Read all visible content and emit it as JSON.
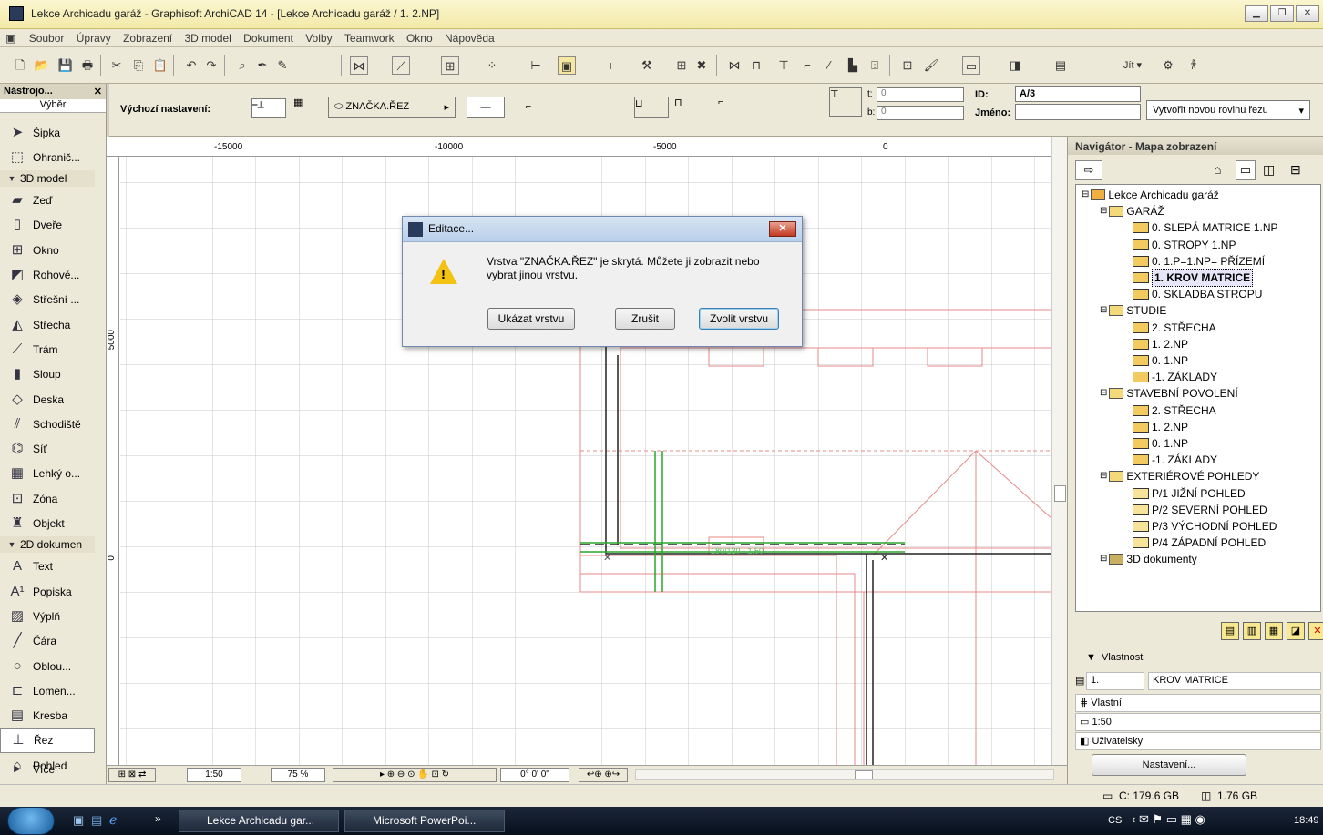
{
  "window": {
    "title": "Lekce Archicadu garáž - Graphisoft ArchiCAD 14 - [Lekce Archicadu garáž / 1. 2.NP]"
  },
  "menubar": [
    "Soubor",
    "Úpravy",
    "Zobrazení",
    "3D model",
    "Dokument",
    "Volby",
    "Teamwork",
    "Okno",
    "Nápověda"
  ],
  "infobox": {
    "default_label": "Výchozí nastavení:",
    "layer_value": "ZNAČKA.ŘEZ",
    "t_label": "t:",
    "t_value": "0",
    "b_label": "b:",
    "b_value": "0",
    "id_label": "ID:",
    "id_value": "A/3",
    "name_label": "Jméno:",
    "create_button": "Vytvořit novou rovinu řezu"
  },
  "toolbox": {
    "title": "Nástrojo...",
    "select_label": "Výběr",
    "tools": [
      {
        "label": "Šipka",
        "icon": "arrow-icon"
      },
      {
        "label": "Ohranič...",
        "icon": "marquee-icon"
      },
      {
        "label": "3D model",
        "icon": "triangle-down-icon",
        "header": true
      },
      {
        "label": "Zeď",
        "icon": "wall-icon"
      },
      {
        "label": "Dveře",
        "icon": "door-icon"
      },
      {
        "label": "Okno",
        "icon": "window-icon"
      },
      {
        "label": "Rohové...",
        "icon": "corner-window-icon"
      },
      {
        "label": "Střešní ...",
        "icon": "skylight-icon"
      },
      {
        "label": "Střecha",
        "icon": "roof-icon"
      },
      {
        "label": "Trám",
        "icon": "beam-icon"
      },
      {
        "label": "Sloup",
        "icon": "column-icon"
      },
      {
        "label": "Deska",
        "icon": "slab-icon"
      },
      {
        "label": "Schodiště",
        "icon": "stair-icon"
      },
      {
        "label": "Síť",
        "icon": "mesh-icon"
      },
      {
        "label": "Lehký o...",
        "icon": "curtain-wall-icon"
      },
      {
        "label": "Zóna",
        "icon": "zone-icon"
      },
      {
        "label": "Objekt",
        "icon": "object-icon"
      },
      {
        "label": "2D dokumen",
        "icon": "triangle-down-icon",
        "header": true
      },
      {
        "label": "Text",
        "icon": "text-icon"
      },
      {
        "label": "Popiska",
        "icon": "label-icon"
      },
      {
        "label": "Výplň",
        "icon": "fill-icon"
      },
      {
        "label": "Čára",
        "icon": "line-icon"
      },
      {
        "label": "Oblou...",
        "icon": "arc-icon"
      },
      {
        "label": "Lomen...",
        "icon": "polyline-icon"
      },
      {
        "label": "Kresba",
        "icon": "drawing-icon"
      },
      {
        "label": "Řez",
        "icon": "section-icon",
        "active": true
      },
      {
        "label": "Pohled",
        "icon": "elevation-icon"
      }
    ],
    "more_label": "Více"
  },
  "canvas": {
    "ruler_ticks": [
      "-15000",
      "-10000",
      "-5000",
      "0"
    ],
    "vruler_ticks": [
      "5000",
      "0"
    ],
    "dim_text": "180/120 - 1,50"
  },
  "bottombar": {
    "scale": "1:50",
    "zoom": "75 %",
    "angle": "0° 0' 0\""
  },
  "navigator": {
    "title": "Navigátor - Mapa zobrazení",
    "tree": [
      {
        "label": "Lekce Archicadu garáž",
        "level": 0,
        "type": "project"
      },
      {
        "label": "GARÁŽ",
        "level": 1,
        "type": "folder"
      },
      {
        "label": "0. SLEPÁ MATRICE 1.NP",
        "level": 2,
        "type": "view"
      },
      {
        "label": "0. STROPY 1.NP",
        "level": 2,
        "type": "view"
      },
      {
        "label": "0. 1.P=1.NP= PŘÍZEMÍ",
        "level": 2,
        "type": "view"
      },
      {
        "label": "1. KROV MATRICE",
        "level": 2,
        "type": "view",
        "selected": true
      },
      {
        "label": "0. SKLADBA STROPU",
        "level": 2,
        "type": "view"
      },
      {
        "label": "STUDIE",
        "level": 1,
        "type": "folder"
      },
      {
        "label": "2. STŘECHA",
        "level": 2,
        "type": "view"
      },
      {
        "label": "1. 2.NP",
        "level": 2,
        "type": "view"
      },
      {
        "label": "0. 1.NP",
        "level": 2,
        "type": "view"
      },
      {
        "label": "-1. ZÁKLADY",
        "level": 2,
        "type": "view"
      },
      {
        "label": "STAVEBNÍ POVOLENÍ",
        "level": 1,
        "type": "folder"
      },
      {
        "label": "2. STŘECHA",
        "level": 2,
        "type": "view"
      },
      {
        "label": "1. 2.NP",
        "level": 2,
        "type": "view"
      },
      {
        "label": "0. 1.NP",
        "level": 2,
        "type": "view"
      },
      {
        "label": "-1. ZÁKLADY",
        "level": 2,
        "type": "view"
      },
      {
        "label": "EXTERIÉROVÉ POHLEDY",
        "level": 1,
        "type": "folder"
      },
      {
        "label": "P/1 JIŽNÍ POHLED",
        "level": 2,
        "type": "elevation"
      },
      {
        "label": "P/2 SEVERNÍ POHLED",
        "level": 2,
        "type": "elevation"
      },
      {
        "label": "P/3 VÝCHODNÍ POHLED",
        "level": 2,
        "type": "elevation"
      },
      {
        "label": "P/4 ZÁPADNÍ POHLED",
        "level": 2,
        "type": "elevation"
      },
      {
        "label": "3D dokumenty",
        "level": 1,
        "type": "3d"
      }
    ],
    "properties_label": "Vlastnosti",
    "prop_id": "1.",
    "prop_name": "KROV MATRICE",
    "prop_layer": "Vlastní",
    "prop_scale": "1:50",
    "prop_user": "Uživatelsky",
    "settings_button": "Nastavení..."
  },
  "status": {
    "disk": "C: 179.6 GB",
    "memory": "1.76 GB"
  },
  "taskbar": {
    "task1": "Lekce Archicadu gar...",
    "task2": "Microsoft PowerPoi...",
    "lang": "CS",
    "clock": "18:49"
  },
  "dialog": {
    "title": "Editace...",
    "message": "Vrstva \"ZNAČKA.ŘEZ\" je skrytá. Můžete ji zobrazit nebo vybrat jinou vrstvu.",
    "btn_show": "Ukázat vrstvu",
    "btn_cancel": "Zrušit",
    "btn_choose": "Zvolit vrstvu"
  }
}
